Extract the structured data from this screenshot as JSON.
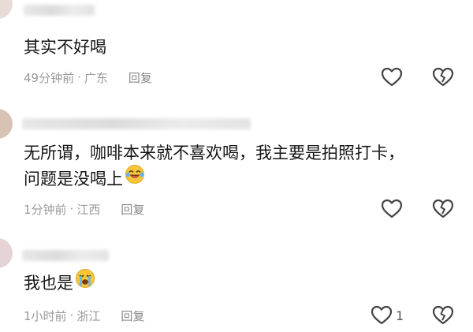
{
  "comments": [
    {
      "text": "其实不好喝",
      "time": "49分钟前",
      "sep": "·",
      "location": "广东",
      "reply_label": "回复",
      "like_count": ""
    },
    {
      "text_line1": "无所谓，咖啡本来就不喜欢喝，我主要是拍照打卡，",
      "text_line2": "问题是没喝上",
      "time": "1分钟前",
      "sep": "·",
      "location": "江西",
      "reply_label": "回复",
      "like_count": ""
    },
    {
      "text": "我也是",
      "time": "1小时前",
      "sep": "·",
      "location": "浙江",
      "reply_label": "回复",
      "like_count": "1"
    }
  ],
  "colors": {
    "text": "#161616",
    "meta": "#9a9a9a",
    "icon": "#444444",
    "emoji_face": "#f7c53a"
  },
  "icons": {
    "like": "heart-outline-icon",
    "dislike": "broken-heart-icon",
    "emoji_laugh": "laughing-tears-emoji-icon",
    "emoji_cry": "crying-emoji-icon"
  }
}
